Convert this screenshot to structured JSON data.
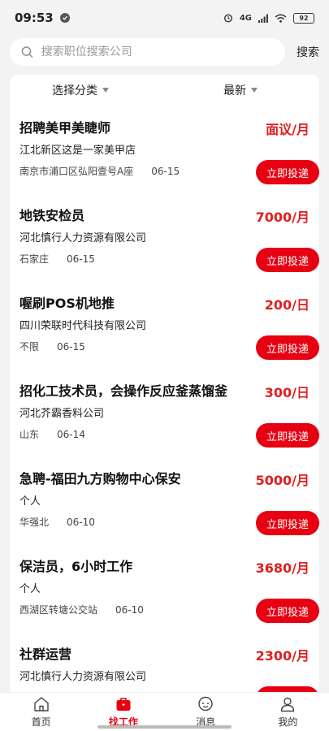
{
  "status": {
    "time": "09:53",
    "network": "4G",
    "battery": "92"
  },
  "search": {
    "placeholder": "搜索职位搜索公司",
    "button_label": "搜索"
  },
  "filters": {
    "category_label": "选择分类",
    "sort_label": "最新"
  },
  "apply_label": "立即投递",
  "jobs": [
    {
      "title": "招聘美甲美睫师",
      "company": "江北新区这是一家美甲店",
      "location": "南京市浦口区弘阳壹号A座",
      "date": "06-15",
      "salary": "面议/月"
    },
    {
      "title": "地铁安检员",
      "company": "河北慎行人力资源有限公司",
      "location": "石家庄",
      "date": "06-15",
      "salary": "7000/月"
    },
    {
      "title": "喔刷POS机地推",
      "company": "四川荣联时代科技有限公司",
      "location": "不限",
      "date": "06-15",
      "salary": "200/日"
    },
    {
      "title": "招化工技术员，会操作反应釜蒸馏釜",
      "company": "河北芥霸香料公司",
      "location": "山东",
      "date": "06-14",
      "salary": "300/日"
    },
    {
      "title": "急聘-福田九方购物中心保安",
      "company": "个人",
      "location": "华强北",
      "date": "06-10",
      "salary": "5000/月"
    },
    {
      "title": "保洁员，6小时工作",
      "company": "个人",
      "location": "西湖区转塘公交站",
      "date": "06-10",
      "salary": "3680/月"
    },
    {
      "title": "社群运营",
      "company": "河北慎行人力资源有限公司",
      "location": "",
      "date": "",
      "salary": "2300/月"
    }
  ],
  "tabs": [
    {
      "label": "首页",
      "icon": "home-icon"
    },
    {
      "label": "找工作",
      "icon": "briefcase-icon"
    },
    {
      "label": "消息",
      "icon": "message-icon"
    },
    {
      "label": "我的",
      "icon": "user-icon"
    }
  ],
  "colors": {
    "accent": "#e60012",
    "salary": "#e02020"
  }
}
